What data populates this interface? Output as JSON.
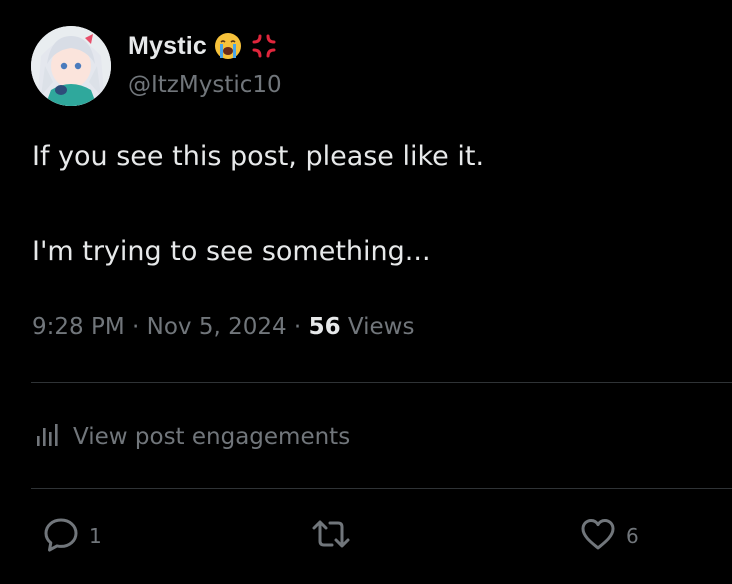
{
  "author": {
    "display_name": "Mystic",
    "handle": "@ItzMystic10",
    "name_emojis": [
      "loudly-crying-face-icon",
      "anger-symbol-icon"
    ]
  },
  "post": {
    "line1": "If you see this post, please like it.",
    "line2": "I'm trying to see something..."
  },
  "meta": {
    "time": "9:28 PM",
    "sep1": " · ",
    "date": "Nov 5, 2024",
    "sep2": " · ",
    "views_count": "56",
    "views_label": " Views"
  },
  "engagements": {
    "label": "View post engagements"
  },
  "actions": {
    "reply_count": "1",
    "repost_count": "",
    "like_count": "6"
  },
  "colors": {
    "background": "#000000",
    "primary_text": "#e7e9ea",
    "secondary_text": "#71767b",
    "divider": "#2f3336"
  }
}
